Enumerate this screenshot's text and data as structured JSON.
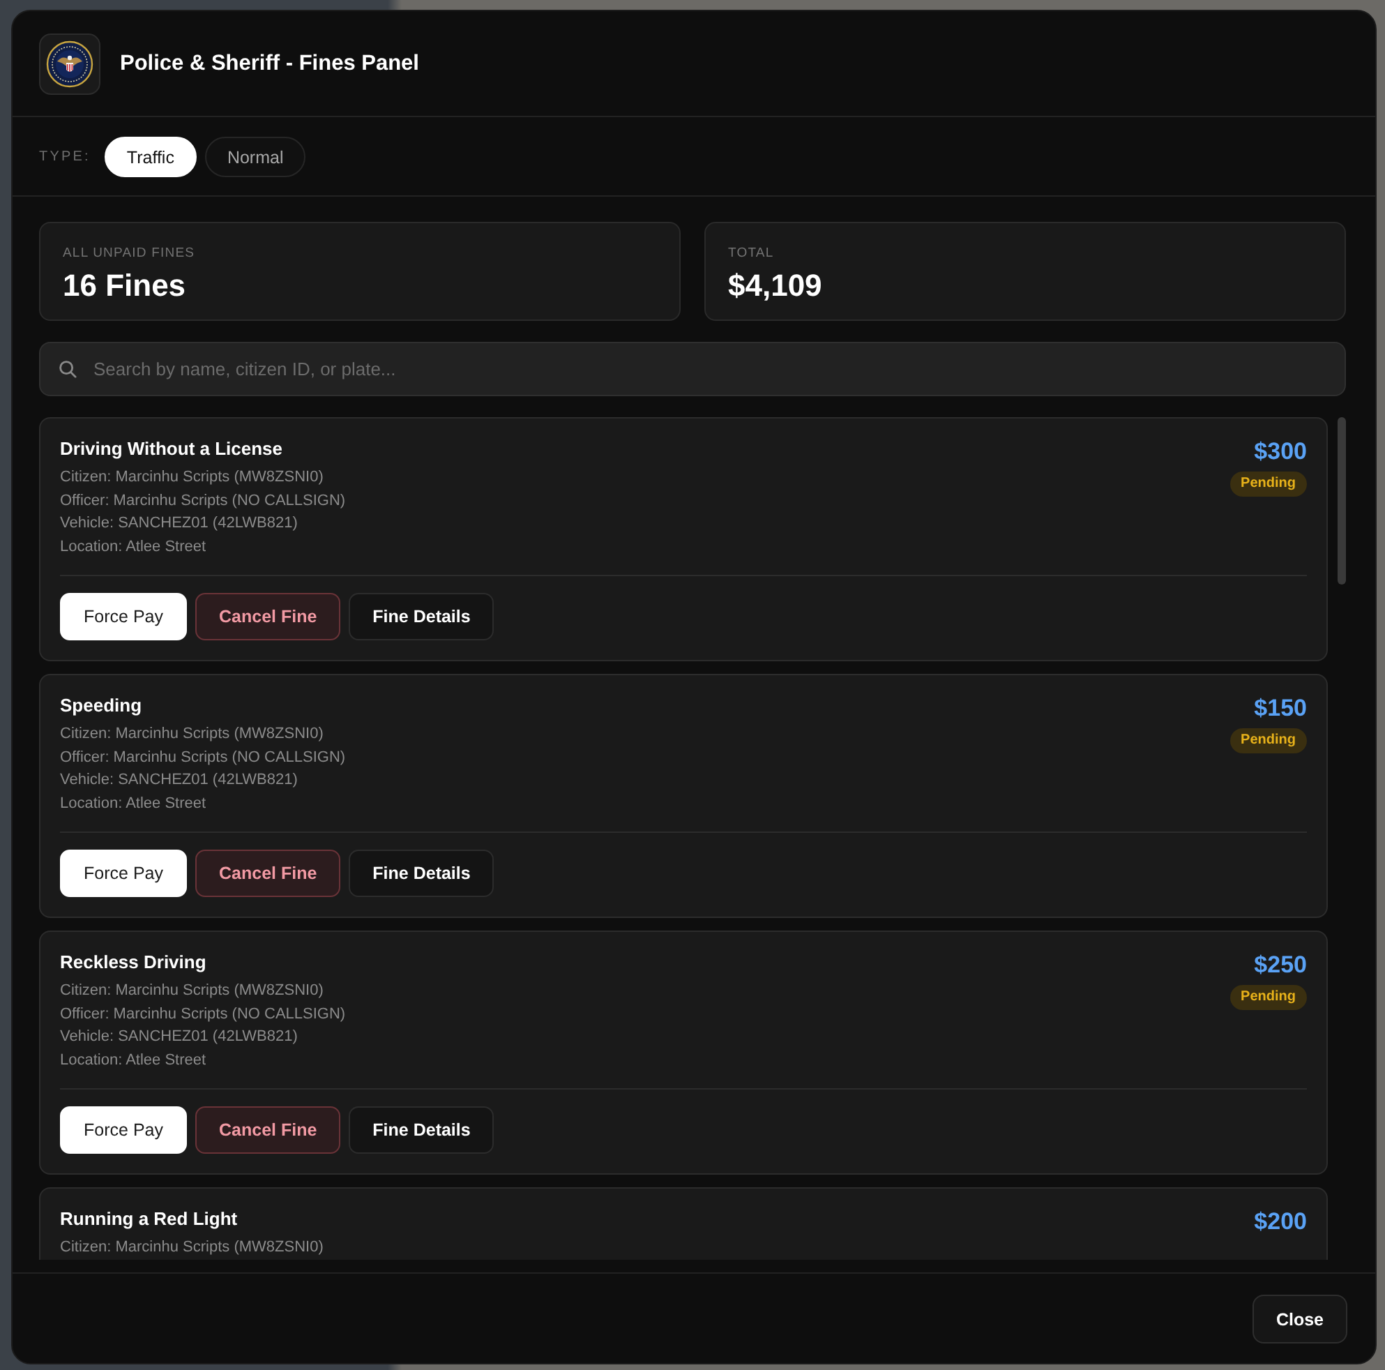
{
  "window": {
    "title": "Police & Sheriff - Fines Panel"
  },
  "type_filter": {
    "label": "TYPE:",
    "options": [
      {
        "label": "Traffic",
        "selected": true
      },
      {
        "label": "Normal",
        "selected": false
      }
    ]
  },
  "stats": [
    {
      "label": "ALL UNPAID FINES",
      "value": "16 Fines"
    },
    {
      "label": "TOTAL",
      "value": "$4,109"
    }
  ],
  "search": {
    "placeholder": "Search by name, citizen ID, or plate..."
  },
  "fines": [
    {
      "title": "Driving Without a License",
      "amount": "$300",
      "status": "Pending",
      "details": [
        "Citizen: Marcinhu Scripts (MW8ZSNI0)",
        "Officer: Marcinhu Scripts (NO CALLSIGN)",
        "Vehicle: SANCHEZ01 (42LWB821)",
        "Location: Atlee Street"
      ],
      "actions": [
        {
          "label": "Force Pay",
          "kind": "light"
        },
        {
          "label": "Cancel Fine",
          "kind": "danger"
        },
        {
          "label": "Fine Details",
          "kind": "dark"
        }
      ]
    },
    {
      "title": "Speeding",
      "amount": "$150",
      "status": "Pending",
      "details": [
        "Citizen: Marcinhu Scripts (MW8ZSNI0)",
        "Officer: Marcinhu Scripts (NO CALLSIGN)",
        "Vehicle: SANCHEZ01 (42LWB821)",
        "Location: Atlee Street"
      ],
      "actions": [
        {
          "label": "Force Pay",
          "kind": "light"
        },
        {
          "label": "Cancel Fine",
          "kind": "danger"
        },
        {
          "label": "Fine Details",
          "kind": "dark"
        }
      ]
    },
    {
      "title": "Reckless Driving",
      "amount": "$250",
      "status": "Pending",
      "details": [
        "Citizen: Marcinhu Scripts (MW8ZSNI0)",
        "Officer: Marcinhu Scripts (NO CALLSIGN)",
        "Vehicle: SANCHEZ01 (42LWB821)",
        "Location: Atlee Street"
      ],
      "actions": [
        {
          "label": "Force Pay",
          "kind": "light"
        },
        {
          "label": "Cancel Fine",
          "kind": "danger"
        },
        {
          "label": "Fine Details",
          "kind": "dark"
        }
      ]
    },
    {
      "title": "Running a Red Light",
      "amount": "$200",
      "details": [
        "Citizen: Marcinhu Scripts (MW8ZSNI0)"
      ]
    }
  ],
  "footer": {
    "close_button": "Close"
  }
}
